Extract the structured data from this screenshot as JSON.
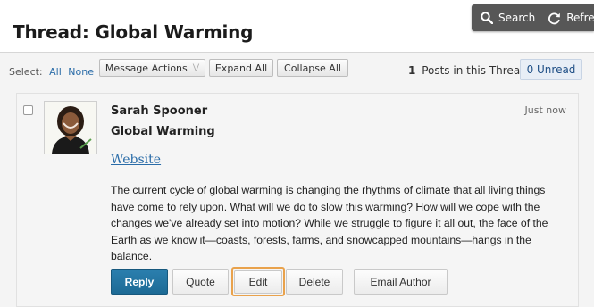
{
  "toolbar": {
    "search_label": "Search",
    "refresh_label": "Refres",
    "search_icon": "search-icon",
    "refresh_icon": "refresh-icon"
  },
  "page": {
    "title": "Thread: Global Warming"
  },
  "actions_bar": {
    "select_label": "Select:",
    "select_all": "All",
    "select_none": "None",
    "message_actions": "Message Actions",
    "expand_all": "Expand All",
    "collapse_all": "Collapse All",
    "posts_count": "1",
    "posts_label": "Posts in this Thread",
    "unread_label": "0 Unread"
  },
  "post": {
    "author": "Sarah Spooner",
    "subject": "Global Warming",
    "timestamp": "Just now",
    "website_label": "Website",
    "body": "The current cycle of global warming is changing the rhythms of climate that all living things have come to rely upon. What will we do to slow this warming? How will we cope with the changes we've already set into motion? While we struggle to figure it all out, the face of the Earth as we know it—coasts, forests, farms, and snowcapped mountains—hangs in the balance.",
    "buttons": {
      "reply": "Reply",
      "quote": "Quote",
      "edit": "Edit",
      "delete": "Delete",
      "email_author": "Email Author"
    }
  },
  "colors": {
    "reply_button": "#1f6f9c",
    "link": "#2a6ca8",
    "focus_ring": "#e9a24c",
    "toolbar_bg": "#575757"
  }
}
